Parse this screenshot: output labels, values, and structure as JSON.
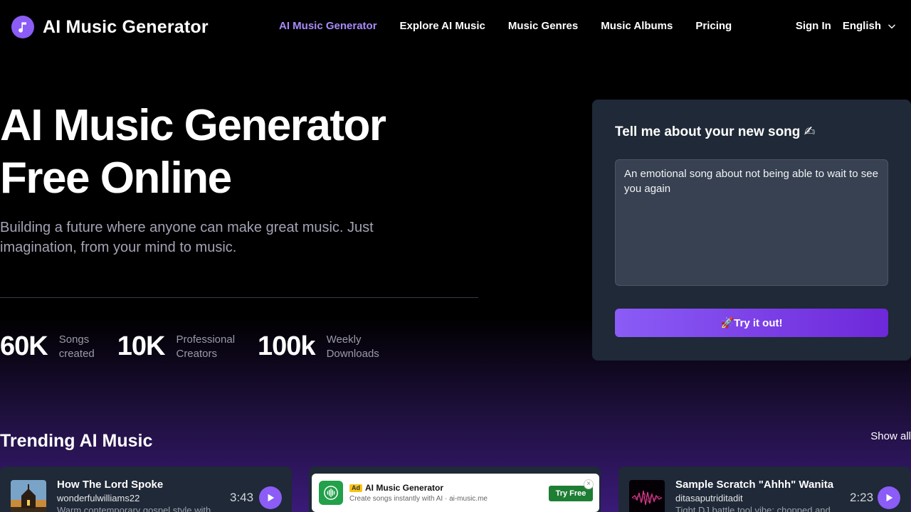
{
  "header": {
    "logo_text": "AI Music Generator",
    "nav": [
      {
        "label": "AI Music Generator",
        "active": true
      },
      {
        "label": "Explore AI Music",
        "active": false
      },
      {
        "label": "Music Genres",
        "active": false
      },
      {
        "label": "Music Albums",
        "active": false
      },
      {
        "label": "Pricing",
        "active": false
      }
    ],
    "sign_in": "Sign In",
    "language": "English"
  },
  "hero": {
    "title_line1": "AI Music Generator",
    "title_line2": "Free Online",
    "subtitle": "Building a future where anyone can make great music. Just imagination, from your mind to music."
  },
  "stats": [
    {
      "value": "60K",
      "label_line1": "Songs",
      "label_line2": "created"
    },
    {
      "value": "10K",
      "label_line1": "Professional",
      "label_line2": "Creators"
    },
    {
      "value": "100k",
      "label_line1": "Weekly",
      "label_line2": "Downloads"
    }
  ],
  "song_form": {
    "title": "Tell me about your new song ✍",
    "prompt_value": "An emotional song about not being able to wait to see you again",
    "submit_label": "🚀Try it out!"
  },
  "trending": {
    "title": "Trending AI Music",
    "show_all": "Show all",
    "tracks": [
      {
        "title": "How The Lord Spoke",
        "artist": "wonderfulwilliams22",
        "desc": "Warm contemporary gospel style with",
        "duration": "3:43"
      },
      {
        "title": "Sample Scratch \"Ahhh\" Wanita",
        "artist": "ditasaputriditadit",
        "desc": "Tight DJ battle tool vibe; chopped and",
        "duration": "2:23"
      }
    ]
  },
  "ad": {
    "badge": "Ad",
    "title": "AI Music Generator",
    "desc": "Create songs instantly with AI · ai-music.me",
    "button": "Try Free",
    "close": "×"
  },
  "colors": {
    "accent": "#8b5cf6",
    "nav_active": "#a78bfa",
    "card_bg": "#1f2937",
    "ad_button": "#1e7e34"
  }
}
